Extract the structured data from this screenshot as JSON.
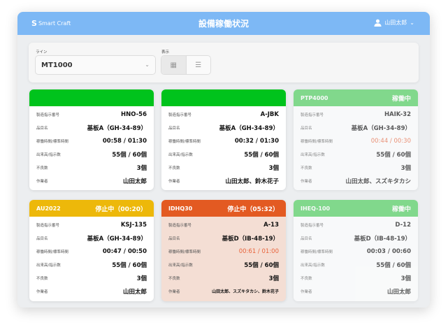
{
  "header": {
    "logo": "Smart Craft",
    "title": "設備稼働状況",
    "user": "山田太郎"
  },
  "filters": {
    "line_label": "ライン",
    "line_value": "MT1000",
    "view_label": "表示"
  },
  "field_labels": [
    "製造指示番号",
    "品目名",
    "稼働時間/標準時間",
    "出来高/指示数",
    "不良数",
    "作業者"
  ],
  "colors": {
    "running": "#00c31c",
    "running_faded": "#5ed36a",
    "stopped": "#edb80a",
    "alert": "#e35a22",
    "alert_bg": "#f4ded4"
  },
  "cards": [
    {
      "name": "",
      "status": "",
      "color": "#00c31c",
      "values": [
        "HNO-56",
        "基板A（GH-34-89）",
        "00:58 / 01:30",
        "55個 / 60個",
        "3個",
        "山田太郎"
      ]
    },
    {
      "name": "",
      "status": "",
      "color": "#00c31c",
      "values": [
        "A-JBK",
        "基板A（GH-34-89）",
        "00:32 / 01:30",
        "55個 / 60個",
        "3個",
        "山田太郎、鈴木花子"
      ]
    },
    {
      "name": "PTP4000",
      "status": "稼働中",
      "color": "#4fce5e",
      "faded": true,
      "warn_time": true,
      "values": [
        "HAIK-32",
        "基板A（GH-34-89）",
        "00:44 / 00:30",
        "55個 / 60個",
        "3個",
        "山田太郎、スズキタカシ"
      ]
    },
    {
      "name": "AU2022",
      "status": "停止中（00:20）",
      "color": "#edb80a",
      "values": [
        "KSJ-135",
        "基板A（GH-34-89）",
        "00:47 / 00:50",
        "55個 / 60個",
        "3個",
        "山田太郎"
      ]
    },
    {
      "name": "IDHQ30",
      "status": "停止中（05:32）",
      "color": "#e35a22",
      "bg": "#f4ded4",
      "warn_time": true,
      "values": [
        "A-13",
        "基板D（IB-48-19）",
        "00:61 / 01:00",
        "55個 / 60個",
        "3個",
        "山田太郎、スズキタカシ、鈴木花子"
      ]
    },
    {
      "name": "IHEQ-100",
      "status": "稼働中",
      "color": "#4fce5e",
      "faded": true,
      "values": [
        "D-12",
        "基板D（IB-48-19）",
        "00:03 / 00:60",
        "55個 / 60個",
        "3個",
        "山田太郎"
      ]
    }
  ]
}
